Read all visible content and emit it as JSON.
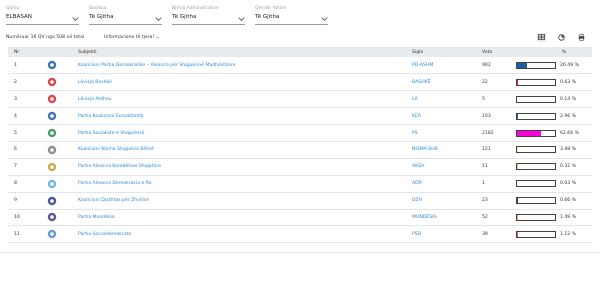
{
  "filters": [
    {
      "label": "Qarku",
      "value": "ELBASAN"
    },
    {
      "label": "Bashkia",
      "value": "Të Gjitha"
    },
    {
      "label": "Njësia Administrative",
      "value": "Të Gjitha"
    },
    {
      "label": "Qendër Votimi",
      "value": "Të Gjitha"
    }
  ],
  "summary": {
    "count_text": "Numëruar 16 QV nga 508 në total",
    "info_link": "Informacione të tjera! ⌄"
  },
  "view_icons": [
    {
      "name": "table-view-icon",
      "active": true
    },
    {
      "name": "pie-chart-icon",
      "active": false
    },
    {
      "name": "print-icon",
      "active": false
    }
  ],
  "table": {
    "headers": {
      "nr": "Nr",
      "logo": "",
      "subject": "Subjekti",
      "abbr": "Sigla",
      "votes": "Vota",
      "bar": "",
      "pct": "%"
    },
    "rows": [
      {
        "nr": "1",
        "name": "Koalicioni Partia Demokratike – Aleanca për Shqipërinë Madhështore",
        "abbr": "PD-ASHM",
        "votes": "902",
        "pct": "26.49 %",
        "share": 0.2649,
        "color": "#1b5fa8",
        "logo_color": "#1b5fa8"
      },
      {
        "nr": "2",
        "name": "Lëvizja Bashkë",
        "abbr": "BASHKË",
        "votes": "22",
        "pct": "0.63 %",
        "share": 0.0063,
        "color": "#d7262b",
        "logo_color": "#d7262b"
      },
      {
        "nr": "3",
        "name": "Lëvizja Atdheu",
        "abbr": "LA",
        "votes": "5",
        "pct": "0.14 %",
        "share": 0.0014,
        "color": "#d7262b",
        "logo_color": "#d7262b"
      },
      {
        "nr": "4",
        "name": "Partia Koalicioni Euroatlantik",
        "abbr": "KEA",
        "votes": "103",
        "pct": "2.96 %",
        "share": 0.0296,
        "color": "#1b5fa8",
        "logo_color": "#1b5fa8"
      },
      {
        "nr": "5",
        "name": "Partia Socialiste e Shqipërisë",
        "abbr": "PS",
        "votes": "2182",
        "pct": "62.66 %",
        "share": 0.6266,
        "color": "#ff00dd",
        "logo_color": "#2e8b57"
      },
      {
        "nr": "6",
        "name": "Koalicioni Nisma Shqipëria Bëhet",
        "abbr": "NISMA-SHB",
        "votes": "121",
        "pct": "3.48 %",
        "share": 0.0348,
        "color": "#f5e6a0",
        "logo_color": "#7a7a7a"
      },
      {
        "nr": "7",
        "name": "Partia Aleanca Kombëtare Shqiptare",
        "abbr": "AKSH",
        "votes": "11",
        "pct": "0.32 %",
        "share": 0.0032,
        "color": "#f5c542",
        "logo_color": "#c79a2b"
      },
      {
        "nr": "8",
        "name": "Partia Aleanca Demokracia e Re",
        "abbr": "ADR",
        "votes": "1",
        "pct": "0.03 %",
        "share": 0.0003,
        "color": "#7ac9f0",
        "logo_color": "#5aaedc"
      },
      {
        "nr": "9",
        "name": "Koalicioni Djathtas për Zhvillim",
        "abbr": "DZH",
        "votes": "23",
        "pct": "0.66 %",
        "share": 0.0066,
        "color": "#2a3a8f",
        "logo_color": "#2a3a8f"
      },
      {
        "nr": "10",
        "name": "Partia Mundësia",
        "abbr": "MUNDËSIA",
        "votes": "52",
        "pct": "1.49 %",
        "share": 0.0149,
        "color": "#f0a030",
        "logo_color": "#3b3b8f"
      },
      {
        "nr": "11",
        "name": "Partia Socialdemokrate",
        "abbr": "PSD",
        "votes": "39",
        "pct": "1.12 %",
        "share": 0.0112,
        "color": "#e04a9a",
        "logo_color": "#4a8ad0"
      }
    ]
  }
}
